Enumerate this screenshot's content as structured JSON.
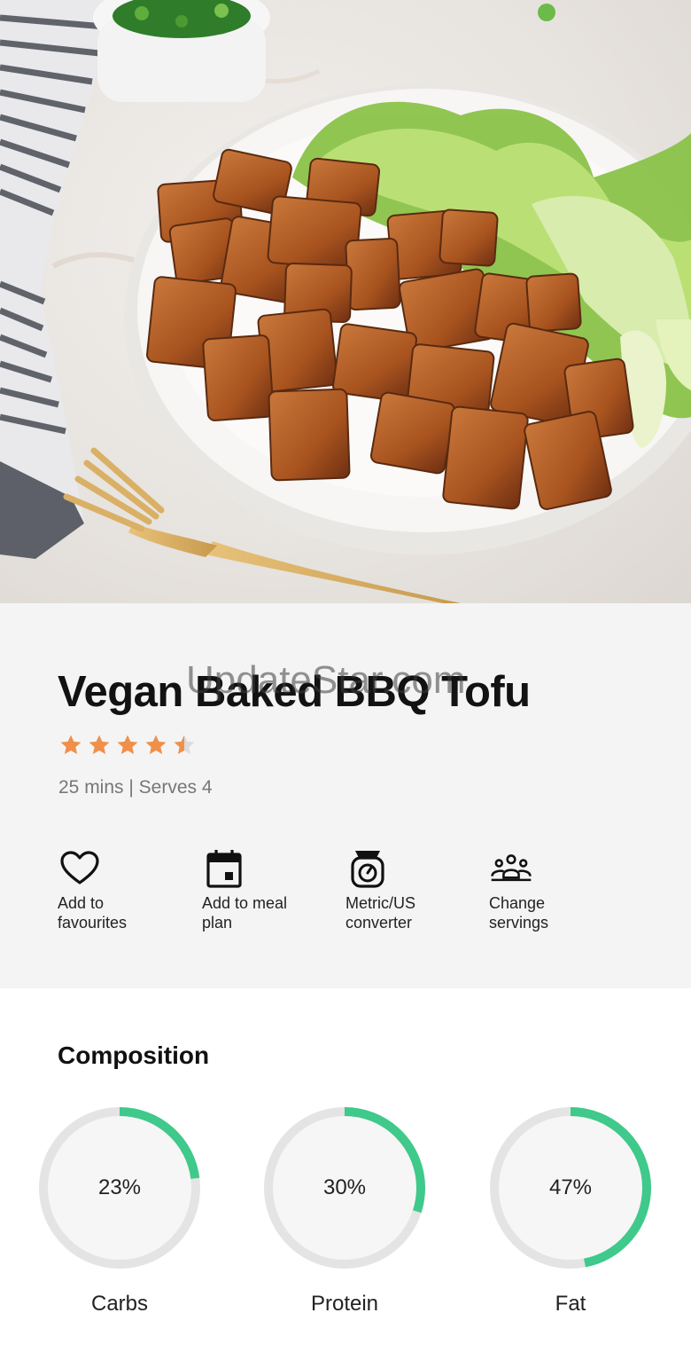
{
  "recipe": {
    "watermark": "UpdateStar.com",
    "title": "Vegan Baked BBQ Tofu",
    "rating": 4.5,
    "meta": "25 mins | Serves 4"
  },
  "actions": [
    {
      "icon": "heart-icon",
      "label": "Add to favourites"
    },
    {
      "icon": "calendar-icon",
      "label": "Add to meal plan"
    },
    {
      "icon": "scale-icon",
      "label": "Metric/US converter"
    },
    {
      "icon": "people-icon",
      "label": "Change servings"
    }
  ],
  "composition": {
    "title": "Composition",
    "items": [
      {
        "label": "Carbs",
        "percent_text": "23%",
        "percent": 23
      },
      {
        "label": "Protein",
        "percent_text": "30%",
        "percent": 30
      },
      {
        "label": "Fat",
        "percent_text": "47%",
        "percent": 47
      }
    ]
  },
  "colors": {
    "accent_green": "#3fc98a",
    "star_orange": "#f08f4a",
    "ring_track": "#e4e4e4",
    "info_background": "#f4f4f4"
  }
}
